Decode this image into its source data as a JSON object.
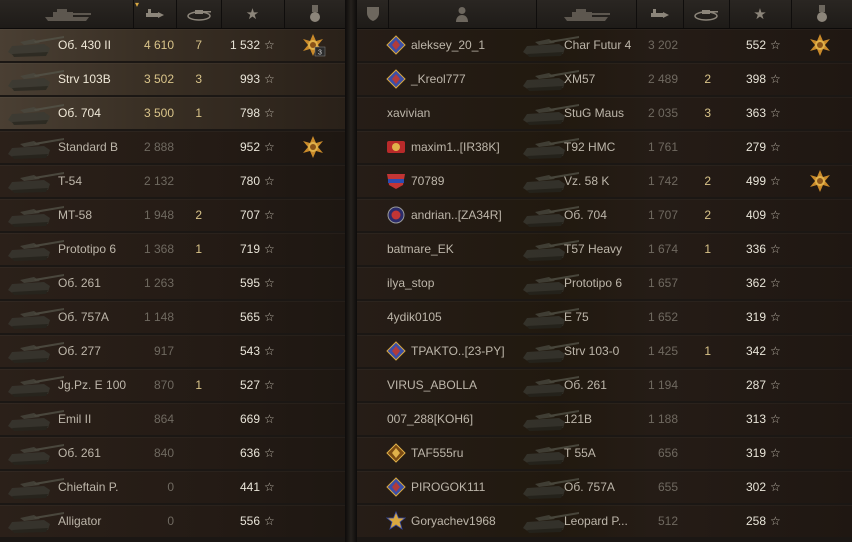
{
  "left": {
    "rows": [
      {
        "tank": "Об. 430 II",
        "battles": "4 610",
        "wins": "7",
        "wn8": "1 532",
        "medal": "3",
        "highlight": true
      },
      {
        "tank": "Strv 103B",
        "battles": "3 502",
        "wins": "3",
        "wn8": "993",
        "medal": "",
        "highlight": true
      },
      {
        "tank": "Об. 704",
        "battles": "3 500",
        "wins": "1",
        "wn8": "798",
        "medal": "",
        "highlight": true
      },
      {
        "tank": "Standard B",
        "battles": "2 888",
        "wins": "",
        "wn8": "952",
        "medal": "",
        "highlight": false,
        "hasMedal": true
      },
      {
        "tank": "T-54",
        "battles": "2 132",
        "wins": "",
        "wn8": "780",
        "medal": "",
        "highlight": false
      },
      {
        "tank": "MT-58",
        "battles": "1 948",
        "wins": "2",
        "wn8": "707",
        "medal": "",
        "highlight": false
      },
      {
        "tank": "Prototipo 6",
        "battles": "1 368",
        "wins": "1",
        "wn8": "719",
        "medal": "",
        "highlight": false
      },
      {
        "tank": "Об. 261",
        "battles": "1 263",
        "wins": "",
        "wn8": "595",
        "medal": "",
        "highlight": false
      },
      {
        "tank": "Об. 757А",
        "battles": "1 148",
        "wins": "",
        "wn8": "565",
        "medal": "",
        "highlight": false
      },
      {
        "tank": "Об. 277",
        "battles": "917",
        "wins": "",
        "wn8": "543",
        "medal": "",
        "highlight": false
      },
      {
        "tank": "Jg.Pz. E 100",
        "battles": "870",
        "wins": "1",
        "wn8": "527",
        "medal": "",
        "highlight": false
      },
      {
        "tank": "Emil II",
        "battles": "864",
        "wins": "",
        "wn8": "669",
        "medal": "",
        "highlight": false
      },
      {
        "tank": "Об. 261",
        "battles": "840",
        "wins": "",
        "wn8": "636",
        "medal": "",
        "highlight": false
      },
      {
        "tank": "Chieftain P.",
        "battles": "0",
        "wins": "",
        "wn8": "441",
        "medal": "",
        "highlight": false
      },
      {
        "tank": "Alligator",
        "battles": "0",
        "wins": "",
        "wn8": "556",
        "medal": "",
        "highlight": false
      }
    ]
  },
  "right": {
    "rows": [
      {
        "player": "aleksey_20_1",
        "icon": "rank-icon",
        "tank": "Char Futur 4",
        "battles": "3 202",
        "wins": "",
        "wn8": "552",
        "hasMedal": true
      },
      {
        "player": "_Kreol777",
        "icon": "rank-icon",
        "tank": "XM57",
        "battles": "2 489",
        "wins": "2",
        "wn8": "398"
      },
      {
        "player": "xavivian",
        "icon": "",
        "tank": "StuG Maus",
        "battles": "2 035",
        "wins": "3",
        "wn8": "363"
      },
      {
        "player": "maxim1..[IR38K]",
        "icon": "clan-icon",
        "tank": "T92 HMC",
        "battles": "1 761",
        "wins": "",
        "wn8": "279"
      },
      {
        "player": "70789",
        "icon": "league-icon",
        "tank": "Vz. 58 K",
        "battles": "1 742",
        "wins": "2",
        "wn8": "499",
        "hasMedal": true
      },
      {
        "player": "andrian..[ZA34R]",
        "icon": "clan-circle-icon",
        "tank": "Об. 704",
        "battles": "1 707",
        "wins": "2",
        "wn8": "409"
      },
      {
        "player": "batmare_EK",
        "icon": "",
        "tank": "T57 Heavy",
        "battles": "1 674",
        "wins": "1",
        "wn8": "336"
      },
      {
        "player": "ilya_stop",
        "icon": "",
        "tank": "Prototipo 6",
        "battles": "1 657",
        "wins": "",
        "wn8": "362"
      },
      {
        "player": "4ydik0105",
        "icon": "",
        "tank": "E 75",
        "battles": "1 652",
        "wins": "",
        "wn8": "319"
      },
      {
        "player": "TPAKTO..[23-PY]",
        "icon": "rank-icon",
        "tank": "Strv 103-0",
        "battles": "1 425",
        "wins": "1",
        "wn8": "342"
      },
      {
        "player": "VIRUS_ABOLLA",
        "icon": "",
        "tank": "Об. 261",
        "battles": "1 194",
        "wins": "",
        "wn8": "287"
      },
      {
        "player": "007_288[KOH6]",
        "icon": "",
        "tank": "121B",
        "battles": "1 188",
        "wins": "",
        "wn8": "313"
      },
      {
        "player": "TAF555ru",
        "icon": "gold-rank-icon",
        "tank": "T 55A",
        "battles": "656",
        "wins": "",
        "wn8": "319"
      },
      {
        "player": "PIROGOK111",
        "icon": "rank-icon",
        "tank": "Об. 757А",
        "battles": "655",
        "wins": "",
        "wn8": "302"
      },
      {
        "player": "Goryachev1968",
        "icon": "star-rank-icon",
        "tank": "Leopard P...",
        "battles": "512",
        "wins": "",
        "wn8": "258"
      }
    ]
  },
  "star_glyph": "☆"
}
